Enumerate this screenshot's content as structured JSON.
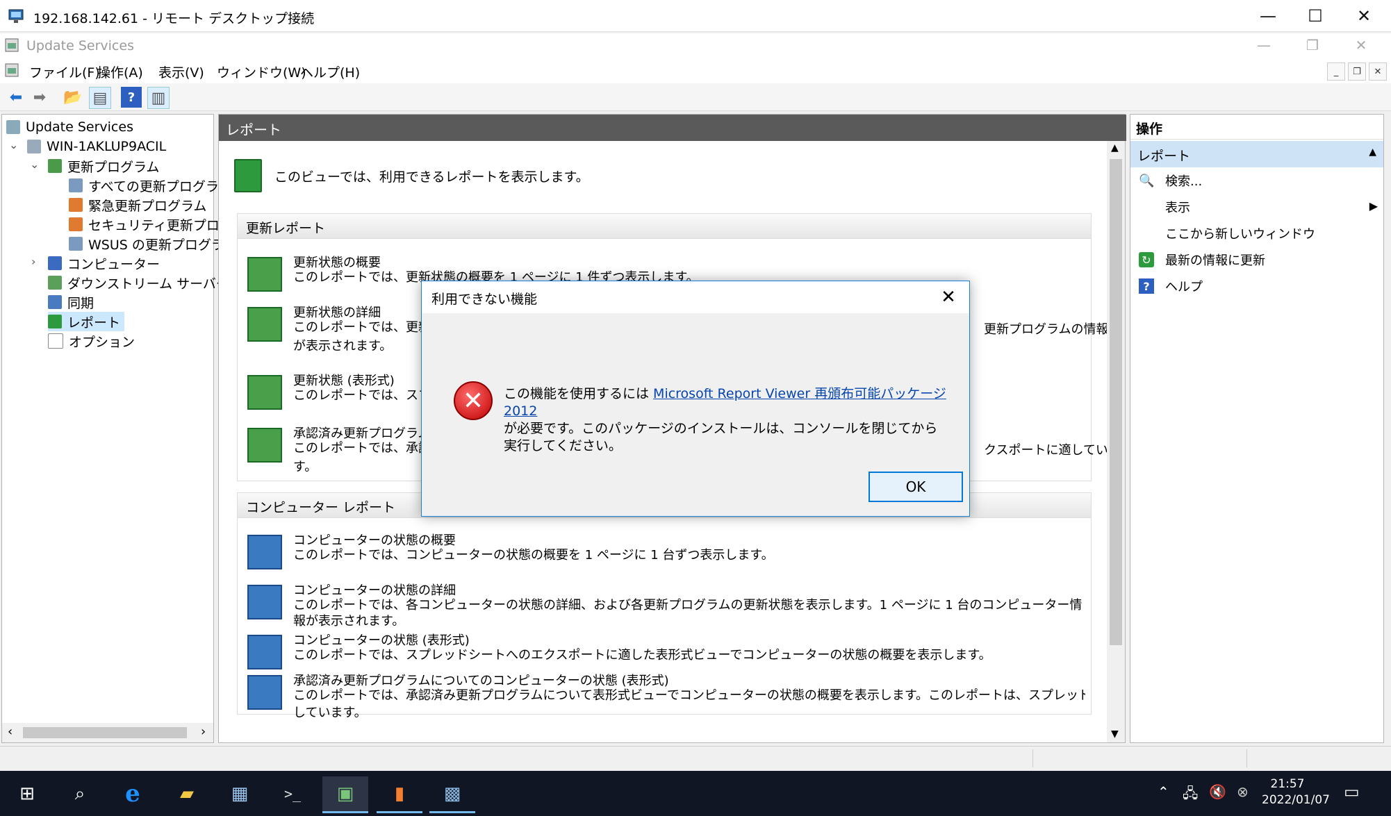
{
  "rdp": {
    "title": "192.168.142.61 - リモート デスクトップ接続",
    "minimize": "—",
    "maximize": "☐",
    "close": "✕"
  },
  "mmc": {
    "title": "Update Services",
    "menu": [
      "ファイル(F)",
      "操作(A)",
      "表示(V)",
      "ウィンドウ(W)",
      "ヘルプ(H)"
    ]
  },
  "tree": {
    "root": "Update Services",
    "server": "WIN-1AKLUP9ACIL",
    "updates": "更新プログラム",
    "all_updates": "すべての更新プログラム",
    "critical": "緊急更新プログラム",
    "security": "セキュリティ更新プログラ",
    "wsus": "WSUS の更新プログラム",
    "computers": "コンピューター",
    "downstream": "ダウンストリーム サーバー",
    "sync": "同期",
    "reports": "レポート",
    "options": "オプション"
  },
  "center": {
    "header": "レポート",
    "intro": "このビューでは、利用できるレポートを表示します。",
    "update_section": "更新レポート",
    "update_reports": [
      {
        "title": "更新状態の概要",
        "desc": "このレポートでは、更新状態の概要を 1 ページに 1 件ずつ表示します。"
      },
      {
        "title": "更新状態の詳細",
        "desc": "このレポートでは、更新状",
        "desc_tail": "更新プログラムの情報",
        "desc2": "が表示されます。"
      },
      {
        "title": "更新状態 (表形式)",
        "desc": "このレポートでは、スプレッ"
      },
      {
        "title": "承認済み更新プログラム(",
        "desc": "このレポートでは、承認済",
        "desc_tail": "クスポートに適していま",
        "desc2": "す。"
      }
    ],
    "computer_section": "コンピューター レポート",
    "computer_reports": [
      {
        "title": "コンピューターの状態の概要",
        "desc": "このレポートでは、コンピューターの状態の概要を 1 ページに 1 台ずつ表示します。"
      },
      {
        "title": "コンピューターの状態の詳細",
        "desc": "このレポートでは、各コンピューターの状態の詳細、および各更新プログラムの更新状態を表示します。1 ページに 1 台のコンピューター情報が表示されます。"
      },
      {
        "title": "コンピューターの状態 (表形式)",
        "desc": "このレポートでは、スプレッドシートへのエクスポートに適した表形式ビューでコンピューターの状態の概要を表示します。"
      },
      {
        "title": "承認済み更新プログラムについてのコンピューターの状態 (表形式)",
        "desc": "このレポートでは、承認済み更新プログラムについて表形式ビューでコンピューターの状態の概要を表示します。このレポートは、スプレッドシートへのエクスポートに適",
        "desc2": "しています。"
      }
    ]
  },
  "actions": {
    "header": "操作",
    "group": "レポート",
    "items": [
      "検索...",
      "表示",
      "ここから新しいウィンドウ",
      "最新の情報に更新",
      "ヘルプ"
    ]
  },
  "dialog": {
    "title": "利用できない機能",
    "msg_prefix": "この機能を使用するには ",
    "link": "Microsoft Report Viewer 再頒布可能パッケージ 2012",
    "msg_suffix": "が必要です。このパッケージのインストールは、コンソールを閉じてから実行してください。",
    "ok": "OK"
  },
  "taskbar": {
    "time": "21:57",
    "date": "2022/01/07"
  },
  "colors": {
    "accent": "#0078d7",
    "header": "#5a5a5a",
    "selection": "#cce8ff",
    "taskbar": "#101623"
  }
}
